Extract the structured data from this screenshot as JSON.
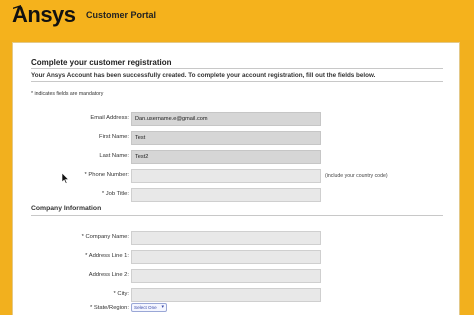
{
  "header": {
    "logo_text": "Ansys",
    "portal_title": "Customer Portal"
  },
  "form": {
    "title": "Complete your customer registration",
    "intro": "Your Ansys Account has been successfully created. To complete your account registration, fill out the fields below.",
    "mandatory_note": "* indicates fields are mandatory",
    "fields": {
      "email": {
        "label": "Email Address:",
        "value": "Dan.username.e@gmail.com"
      },
      "first_name": {
        "label": "First Name:",
        "value": "Test"
      },
      "last_name": {
        "label": "Last Name:",
        "value": "Test2"
      },
      "phone": {
        "label": "* Phone Number:",
        "value": "",
        "hint": "(include your country code)"
      },
      "job_title": {
        "label": "* Job Title:",
        "value": ""
      }
    },
    "company_section": {
      "title": "Company Information",
      "fields": {
        "company_name": {
          "label": "* Company Name:",
          "value": ""
        },
        "address1": {
          "label": "* Address Line 1:",
          "value": ""
        },
        "address2": {
          "label": "Address Line 2:",
          "value": ""
        },
        "city": {
          "label": "* City:",
          "value": ""
        },
        "state": {
          "label": "* State/Region:",
          "value": "Select One"
        }
      }
    }
  },
  "colors": {
    "brand_yellow": "#f5b21c",
    "input_readonly": "#d6d6d6",
    "input_empty": "#e8e8e8"
  }
}
